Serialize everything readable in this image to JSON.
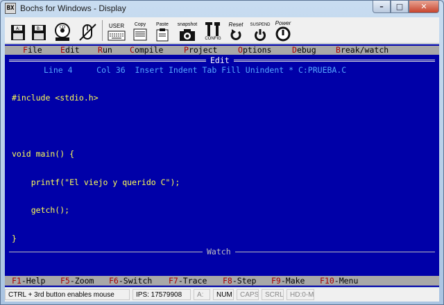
{
  "window": {
    "title": "Bochs for Windows - Display",
    "icon_text": "BX"
  },
  "toolbar": {
    "buttons": [
      {
        "label": "A:"
      },
      {
        "label": "B:"
      },
      {
        "label": "CD"
      },
      {
        "label": ""
      },
      {
        "label": "USER"
      },
      {
        "label": "Copy"
      },
      {
        "label": "Paste"
      },
      {
        "label": "snapshot"
      },
      {
        "label": "CONFIG"
      },
      {
        "label": "Reset"
      },
      {
        "label": "SUSPEND"
      },
      {
        "label": "Power"
      }
    ]
  },
  "dos": {
    "menu": [
      {
        "hot": "F",
        "rest": "ile"
      },
      {
        "hot": "E",
        "rest": "dit"
      },
      {
        "hot": "R",
        "rest": "un"
      },
      {
        "hot": "C",
        "rest": "ompile"
      },
      {
        "hot": "P",
        "rest": "roject"
      },
      {
        "hot": "O",
        "rest": "ptions"
      },
      {
        "hot": "D",
        "rest": "ebug"
      },
      {
        "hot": "B",
        "rest": "reak/watch"
      }
    ],
    "edit_title": "Edit",
    "status_line": "Line 4     Col 36  Insert Indent Tab Fill Unindent * C:PRUEBA.C",
    "code_lines": [
      "#include <stdio.h>",
      "",
      "void main() {",
      "    printf(\"El viejo y querido C\");",
      "    getch();",
      "}"
    ],
    "watch_title": "Watch",
    "fkeys": [
      {
        "key": "F1",
        "label": "-Help"
      },
      {
        "key": "F5",
        "label": "-Zoom"
      },
      {
        "key": "F6",
        "label": "-Switch"
      },
      {
        "key": "F7",
        "label": "-Trace"
      },
      {
        "key": "F8",
        "label": "-Step"
      },
      {
        "key": "F9",
        "label": "-Make"
      },
      {
        "key": "F10",
        "label": "-Menu"
      }
    ]
  },
  "statusbar": {
    "hint": "CTRL + 3rd button enables mouse",
    "ips": "IPS: 17579908",
    "drive": "A:",
    "num": "NUM",
    "caps": "CAPS",
    "scrl": "SCRL",
    "hd": "HD:0-M"
  },
  "colors": {
    "dos_background": "#0000a8",
    "menu_gray": "#a8a8a8",
    "hotkey_red": "#a80000",
    "code_yellow": "#ffff54",
    "status_cyan": "#56a8ff"
  }
}
